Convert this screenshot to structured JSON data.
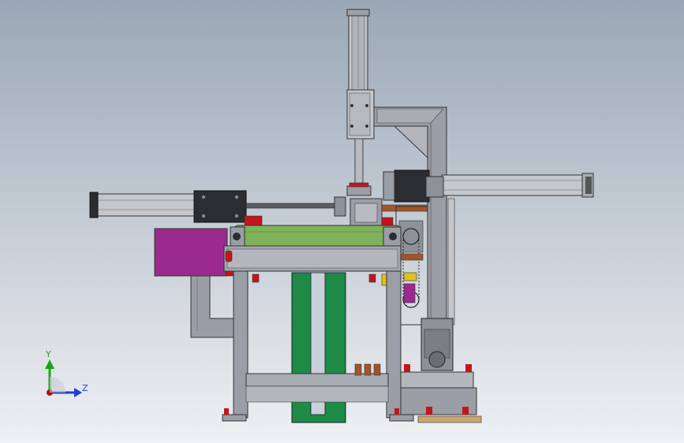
{
  "viewport": {
    "background_top": "#9aa7b6",
    "background_bottom": "#eef0f3"
  },
  "triad": {
    "y_label": "Y",
    "z_label": "Z",
    "y_color": "#1aa51a",
    "z_color": "#1f3fd0",
    "origin_color": "#b01010"
  },
  "colors": {
    "frame": "#9a9ea6",
    "frame_dark": "#55585e",
    "cylinder": "#c4c7cc",
    "block": "#2b2d31",
    "roller": "#7fb05a",
    "magenta_guard": "#9b2a8e",
    "green_belt": "#1f8a45",
    "red_part": "#c4141c",
    "copper": "#a0562a",
    "yellow_part": "#e2c21a"
  }
}
